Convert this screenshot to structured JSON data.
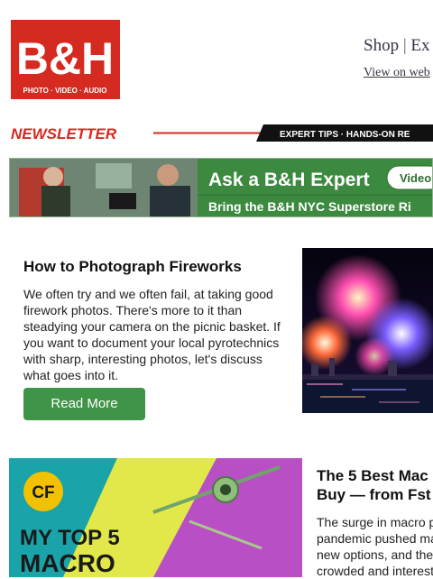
{
  "logo": {
    "main": "B&H",
    "tagline": "PHOTO · VIDEO · AUDIO",
    "color": "#d42a20"
  },
  "header": {
    "nav_shop": "Shop",
    "nav_separator": "|",
    "nav_partial": "Ex",
    "web_link": "View on web"
  },
  "newsletter_bar": {
    "title": "NEWSLETTER",
    "tagline": "EXPERT TIPS · HANDS-ON RE"
  },
  "banner": {
    "headline": "Ask a B&H Expert",
    "button_partial": "Video",
    "subline": "Bring the B&H NYC Superstore Ri",
    "color": "#3c8a3f"
  },
  "article1": {
    "title": "How to Photograph Fireworks",
    "body": "We often try and we often fail, at taking good firework photos. There's more to it than steadying your camera on the picnic basket. If you want to document your local pyrotechnics with sharp, interesting photos, let's discuss what goes into it.",
    "button": "Read More",
    "button_color": "#3f9447"
  },
  "article2": {
    "title_line1": "The 5 Best Mac",
    "title_line2": "Buy — from Fst",
    "body_lines": [
      "The surge in macro p",
      "pandemic pushed ma",
      "new options, and the",
      "crowded and interest"
    ],
    "image_badge": "CF",
    "image_line1": "MY TOP 5",
    "image_line2": "MACRO"
  }
}
